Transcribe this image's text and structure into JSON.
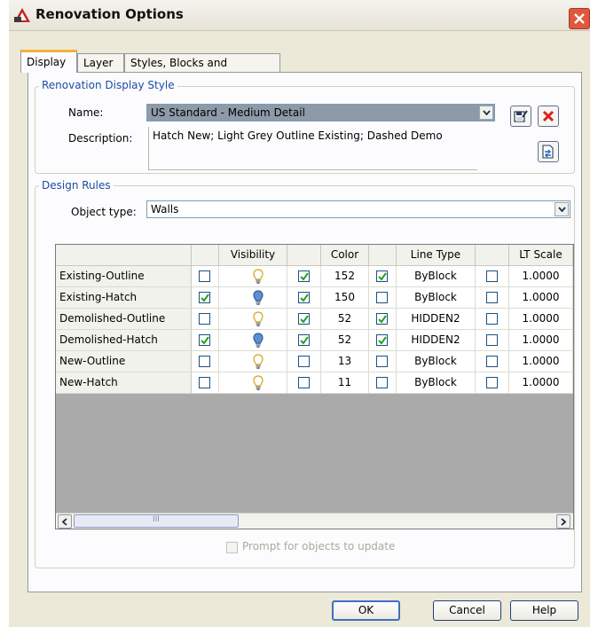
{
  "window": {
    "title": "Renovation Options",
    "close": "close"
  },
  "tabs": [
    {
      "label": "Display",
      "active": true
    },
    {
      "label": "Layer",
      "active": false
    },
    {
      "label": "Styles, Blocks and Materials",
      "active": false
    }
  ],
  "display_style": {
    "group_title": "Renovation Display Style",
    "name_label": "Name:",
    "name_value": "US Standard - Medium Detail",
    "description_label": "Description:",
    "description_value": "Hatch New; Light Grey Outline Existing; Dashed Demo"
  },
  "design_rules": {
    "group_title": "Design Rules",
    "object_type_label": "Object type:",
    "object_type_value": "Walls",
    "columns": [
      "",
      "Visibility",
      "",
      "Color",
      "",
      "Line Type",
      "",
      "LT Scale"
    ],
    "rows": [
      {
        "name": "Existing-Outline",
        "vis_check": false,
        "bulb": "off",
        "color_check": true,
        "color": "152",
        "lt_check": true,
        "line_type": "ByBlock",
        "lts_check": false,
        "lt_scale": "1.0000"
      },
      {
        "name": "Existing-Hatch",
        "vis_check": true,
        "bulb": "on",
        "color_check": true,
        "color": "150",
        "lt_check": false,
        "line_type": "ByBlock",
        "lts_check": false,
        "lt_scale": "1.0000"
      },
      {
        "name": "Demolished-Outline",
        "vis_check": false,
        "bulb": "off",
        "color_check": true,
        "color": "52",
        "lt_check": true,
        "line_type": "HIDDEN2",
        "lts_check": false,
        "lt_scale": "1.0000"
      },
      {
        "name": "Demolished-Hatch",
        "vis_check": true,
        "bulb": "on",
        "color_check": true,
        "color": "52",
        "lt_check": true,
        "line_type": "HIDDEN2",
        "lts_check": false,
        "lt_scale": "1.0000"
      },
      {
        "name": "New-Outline",
        "vis_check": false,
        "bulb": "off",
        "color_check": false,
        "color": "13",
        "lt_check": false,
        "line_type": "ByBlock",
        "lts_check": false,
        "lt_scale": "1.0000"
      },
      {
        "name": "New-Hatch",
        "vis_check": false,
        "bulb": "off",
        "color_check": false,
        "color": "11",
        "lt_check": false,
        "line_type": "ByBlock",
        "lts_check": false,
        "lt_scale": "1.0000"
      }
    ],
    "scroll_grip": "III",
    "prompt_label": "Prompt for objects to update",
    "prompt_checked": false
  },
  "buttons": {
    "ok": "OK",
    "cancel": "Cancel",
    "help": "Help"
  },
  "colors": {
    "title_accent": "#f1b43a",
    "group_title": "#1c4da3",
    "check_mark": "#21a121",
    "close_red": "#e0573e",
    "bulb_off": "#f5d84a",
    "bulb_on": "#5b8fd6"
  },
  "icons": {
    "app": "autocad-icon",
    "save": "save-edit-icon",
    "delete": "delete-x-icon",
    "import": "import-style-icon"
  }
}
